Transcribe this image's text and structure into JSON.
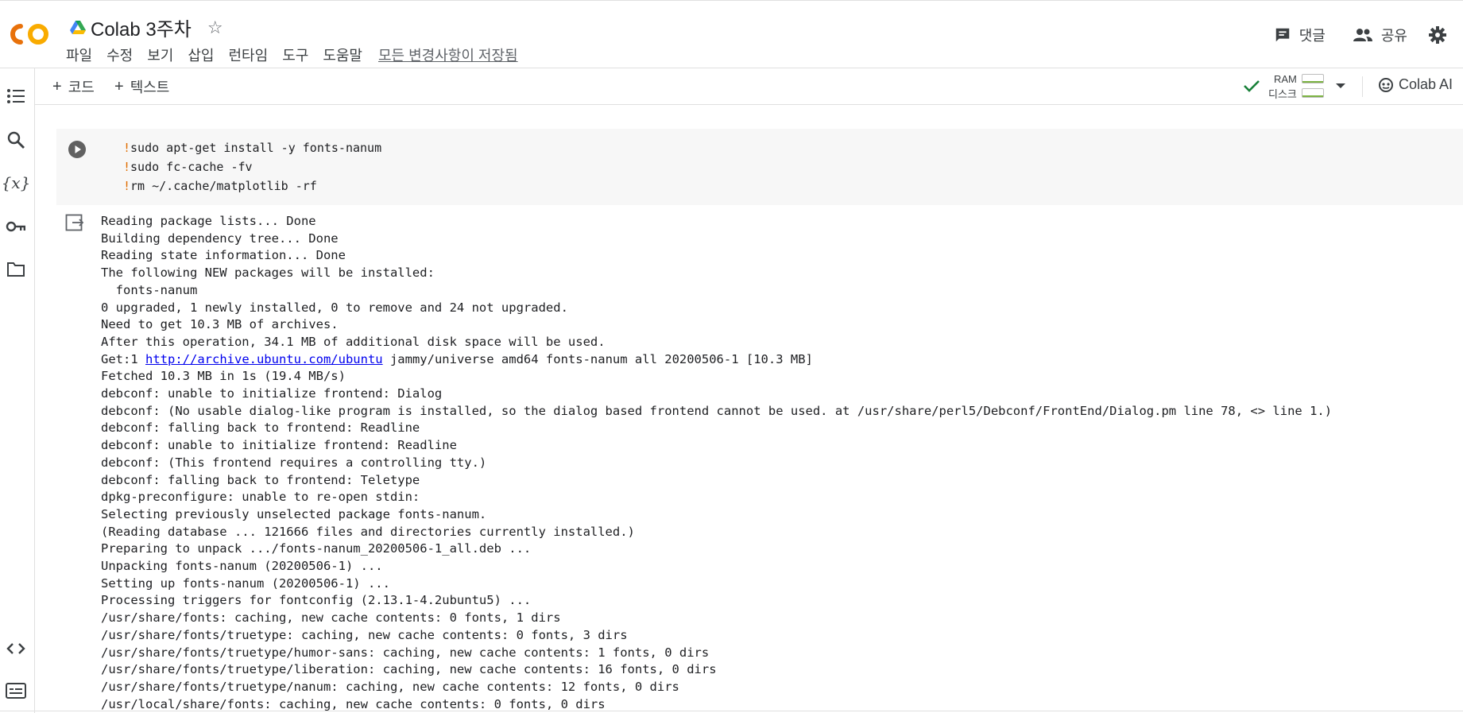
{
  "header": {
    "title": "Colab 3주차",
    "menu": [
      "파일",
      "수정",
      "보기",
      "삽입",
      "런타임",
      "도구",
      "도움말"
    ],
    "saved_status": "모든 변경사항이 저장됨",
    "comment_label": "댓글",
    "share_label": "공유"
  },
  "toolbar": {
    "add_code_label": "코드",
    "add_text_label": "텍스트",
    "ram_label": "RAM",
    "disk_label": "디스크",
    "colab_ai_label": "Colab AI"
  },
  "cell": {
    "code_lines": [
      {
        "bang": "!",
        "rest": "sudo apt-get install -y fonts-nanum"
      },
      {
        "bang": "!",
        "rest": "sudo fc-cache -fv"
      },
      {
        "bang": "!",
        "rest": "rm ~/.cache/matplotlib -rf"
      }
    ],
    "output_lines": [
      "Reading package lists... Done",
      "Building dependency tree... Done",
      "Reading state information... Done",
      "The following NEW packages will be installed:",
      "  fonts-nanum",
      "0 upgraded, 1 newly installed, 0 to remove and 24 not upgraded.",
      "Need to get 10.3 MB of archives.",
      "After this operation, 34.1 MB of additional disk space will be used."
    ],
    "get_line": {
      "prefix": "Get:1 ",
      "link": "http://archive.ubuntu.com/ubuntu",
      "suffix": " jammy/universe amd64 fonts-nanum all 20200506-1 [10.3 MB]"
    },
    "output_lines_2": [
      "Fetched 10.3 MB in 1s (19.4 MB/s)",
      "debconf: unable to initialize frontend: Dialog",
      "debconf: (No usable dialog-like program is installed, so the dialog based frontend cannot be used. at /usr/share/perl5/Debconf/FrontEnd/Dialog.pm line 78, <> line 1.)",
      "debconf: falling back to frontend: Readline",
      "debconf: unable to initialize frontend: Readline",
      "debconf: (This frontend requires a controlling tty.)",
      "debconf: falling back to frontend: Teletype",
      "dpkg-preconfigure: unable to re-open stdin: ",
      "Selecting previously unselected package fonts-nanum.",
      "(Reading database ... 121666 files and directories currently installed.)",
      "Preparing to unpack .../fonts-nanum_20200506-1_all.deb ...",
      "Unpacking fonts-nanum (20200506-1) ...",
      "Setting up fonts-nanum (20200506-1) ...",
      "Processing triggers for fontconfig (2.13.1-4.2ubuntu5) ...",
      "/usr/share/fonts: caching, new cache contents: 0 fonts, 1 dirs",
      "/usr/share/fonts/truetype: caching, new cache contents: 0 fonts, 3 dirs",
      "/usr/share/fonts/truetype/humor-sans: caching, new cache contents: 1 fonts, 0 dirs",
      "/usr/share/fonts/truetype/liberation: caching, new cache contents: 16 fonts, 0 dirs",
      "/usr/share/fonts/truetype/nanum: caching, new cache contents: 12 fonts, 0 dirs",
      "/usr/local/share/fonts: caching, new cache contents: 0 fonts, 0 dirs"
    ]
  },
  "colors": {
    "logo_orange": "#f9ab00",
    "logo_dark_orange": "#e8710a",
    "link": "#0000ee",
    "check_green": "#188038"
  },
  "icons": {
    "rail": [
      "toc-icon",
      "search-icon",
      "variables-icon",
      "key-icon",
      "folder-icon",
      "code-snippets-icon",
      "terminal-icon"
    ]
  }
}
